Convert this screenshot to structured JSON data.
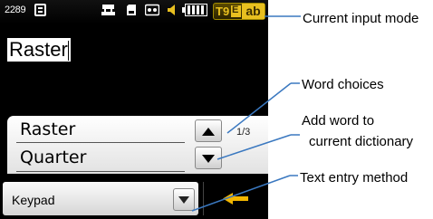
{
  "status_bar": {
    "counter": "2289",
    "icons": [
      "e-icon",
      "network-icon",
      "memory-card-icon",
      "cassette-icon",
      "speaker-icon",
      "battery-icon"
    ],
    "input_mode_t9": "T9",
    "input_mode_e": "E",
    "input_mode_case": "ab"
  },
  "text_field": {
    "value": "Raster"
  },
  "word_choices": {
    "words": [
      "Raster",
      "Quarter"
    ],
    "page": "1/3"
  },
  "entry_method": {
    "selected": "Keypad"
  },
  "callouts": {
    "input_mode": "Current input mode",
    "word_choices": "Word choices",
    "add_word_line1": "Add word to",
    "add_word_line2": "current dictionary",
    "entry_method": "Text entry method"
  },
  "colors": {
    "accent": "#e8c020",
    "back_arrow": "#f2b600",
    "screen_bg": "#000000"
  }
}
